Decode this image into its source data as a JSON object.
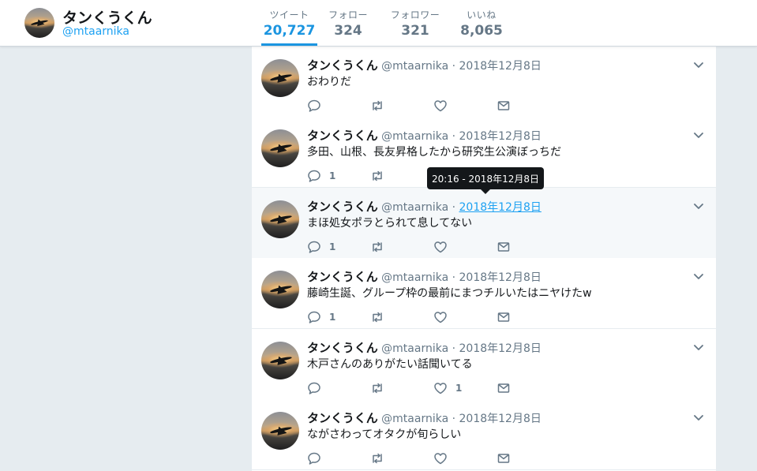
{
  "profile": {
    "name": "タンくうくん",
    "handle": "@mtaarnika"
  },
  "stats": [
    {
      "label": "ツイート",
      "value": "20,727",
      "active": true
    },
    {
      "label": "フォロー",
      "value": "324"
    },
    {
      "label": "フォロワー",
      "value": "321"
    },
    {
      "label": "いいね",
      "value": "8,065"
    }
  ],
  "tooltip": {
    "text": "20:16 - 2018年12月8日"
  },
  "tweets": [
    {
      "name": "タンくうくん",
      "handle": "@mtaarnika",
      "dot": "·",
      "date": "2018年12月8日",
      "text": "おわりだ",
      "replies": "",
      "retweets": "",
      "likes": ""
    },
    {
      "name": "タンくうくん",
      "handle": "@mtaarnika",
      "dot": "·",
      "date": "2018年12月8日",
      "text": "多田、山根、長友昇格したから研究生公演ぼっちだ",
      "replies": "1",
      "retweets": "",
      "likes": ""
    },
    {
      "name": "タンくうくん",
      "handle": "@mtaarnika",
      "dot": "·",
      "date": "2018年12月8日",
      "text": "まほ処女ポラとられて息してない",
      "replies": "1",
      "retweets": "",
      "likes": ""
    },
    {
      "name": "タンくうくん",
      "handle": "@mtaarnika",
      "dot": "·",
      "date": "2018年12月8日",
      "text": "藤崎生誕、グループ枠の最前にまつチルいたはニヤけたw",
      "replies": "1",
      "retweets": "",
      "likes": ""
    },
    {
      "name": "タンくうくん",
      "handle": "@mtaarnika",
      "dot": "·",
      "date": "2018年12月8日",
      "text": "木戸さんのありがたい話聞いてる",
      "replies": "",
      "retweets": "",
      "likes": "1"
    },
    {
      "name": "タンくうくん",
      "handle": "@mtaarnika",
      "dot": "·",
      "date": "2018年12月8日",
      "text": "ながさわってオタクが旬らしい",
      "replies": "",
      "retweets": "",
      "likes": ""
    }
  ],
  "icons": {
    "reply": "reply-icon",
    "retweet": "retweet-icon",
    "like": "heart-icon",
    "dm": "envelope-icon",
    "caret": "chevron-down-icon"
  },
  "colors": {
    "accent": "#1da1f2",
    "muted": "#657786",
    "background": "#e6ecf0"
  }
}
